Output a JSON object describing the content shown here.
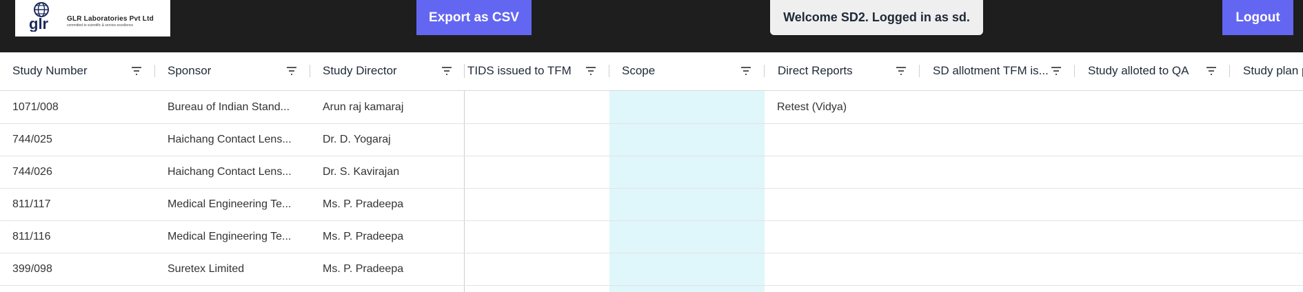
{
  "brand": {
    "logo_text": "glr",
    "company": "GLR Laboratories Pvt Ltd",
    "tagline": "committed to scientific & service excellence"
  },
  "header": {
    "export_label": "Export as CSV",
    "welcome_text": "Welcome SD2. Logged in as sd.",
    "logout_label": "Logout"
  },
  "colors": {
    "primary": "#6366f1",
    "topbar": "#1e1e1e",
    "scope_highlight": "#dff6fa"
  },
  "table": {
    "columns": [
      {
        "label": "Study Number",
        "icon": "filter-icon"
      },
      {
        "label": "Sponsor",
        "icon": "filter-icon"
      },
      {
        "label": "Study Director",
        "icon": "filter-icon"
      },
      {
        "label": "TIDS issued to TFM",
        "icon": "filter-icon"
      },
      {
        "label": "Scope",
        "icon": "filter-icon"
      },
      {
        "label": "Direct Reports",
        "icon": "filter-icon"
      },
      {
        "label": "SD allotment TFM is...",
        "icon": "filter-icon"
      },
      {
        "label": "Study alloted to QA",
        "icon": "filter-icon"
      },
      {
        "label": "Study plan p"
      }
    ],
    "rows": [
      {
        "study_number": "1071/008",
        "sponsor": "Bureau of Indian Stand...",
        "director": "Arun raj kamaraj",
        "direct_reports": "Retest (Vidya)"
      },
      {
        "study_number": "744/025",
        "sponsor": "Haichang Contact Lens...",
        "director": "Dr. D. Yogaraj",
        "direct_reports": ""
      },
      {
        "study_number": "744/026",
        "sponsor": "Haichang Contact Lens...",
        "director": "Dr. S. Kavirajan",
        "direct_reports": ""
      },
      {
        "study_number": "811/117",
        "sponsor": "Medical Engineering Te...",
        "director": "Ms. P. Pradeepa",
        "direct_reports": ""
      },
      {
        "study_number": "811/116",
        "sponsor": "Medical Engineering Te...",
        "director": "Ms. P. Pradeepa",
        "direct_reports": ""
      },
      {
        "study_number": "399/098",
        "sponsor": "Suretex Limited",
        "director": "Ms. P. Pradeepa",
        "direct_reports": ""
      }
    ]
  }
}
